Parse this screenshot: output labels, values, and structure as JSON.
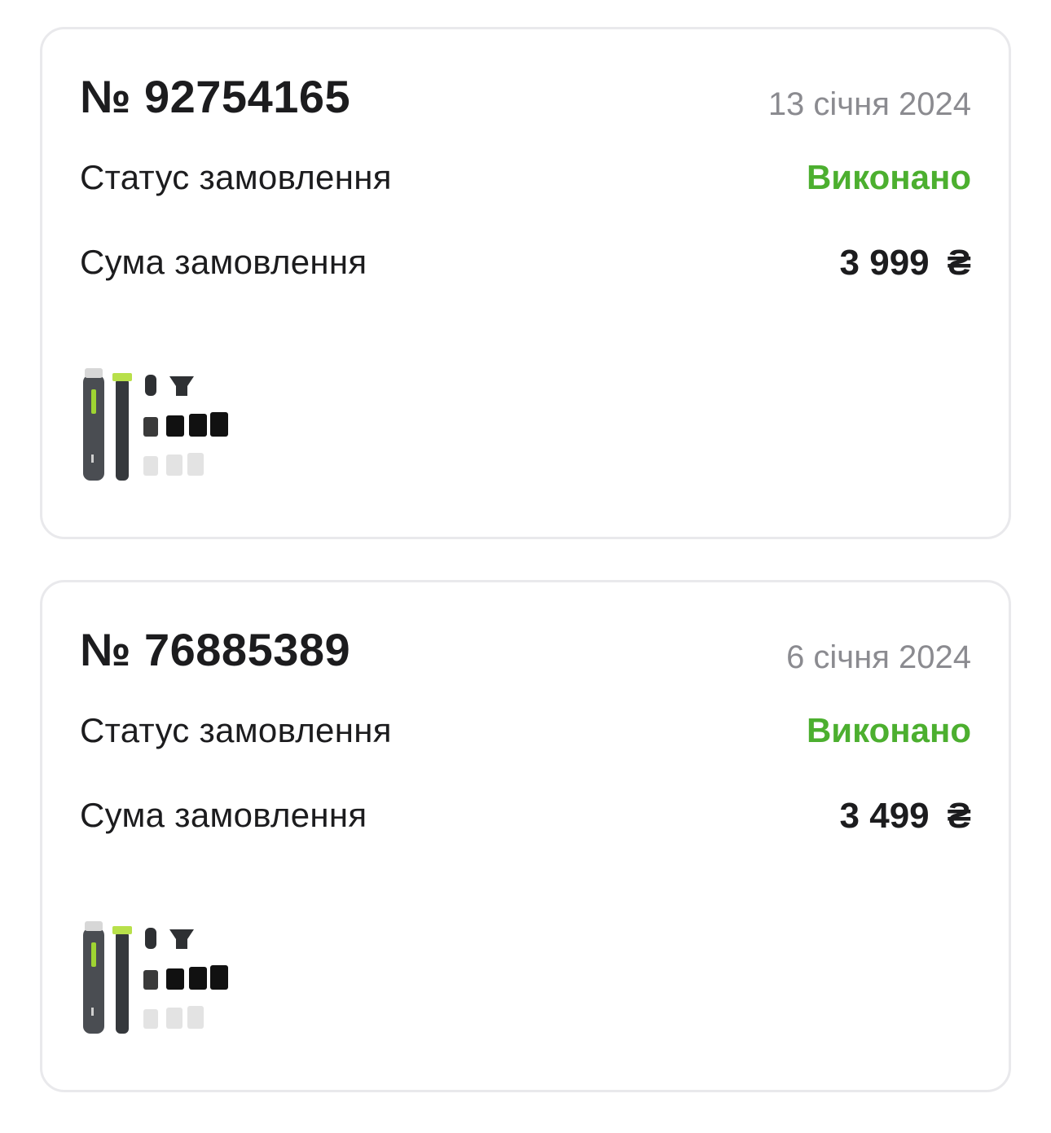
{
  "orders": [
    {
      "number": "№ 92754165",
      "date": "13 січня 2024",
      "status_label": "Статус замовлення",
      "status_value": "Виконано",
      "sum_label": "Сума замовлення",
      "sum_amount": "3 999",
      "currency": "₴",
      "product_image": "trimmer-kit-image"
    },
    {
      "number": "№ 76885389",
      "date": "6 січня 2024",
      "status_label": "Статус замовлення",
      "status_value": "Виконано",
      "sum_label": "Сума замовлення",
      "sum_amount": "3 499",
      "currency": "₴",
      "product_image": "trimmer-kit-image"
    }
  ],
  "colors": {
    "status_done": "#4caf2f",
    "date_text": "#8b8b90",
    "card_border": "#e9e9ec"
  }
}
